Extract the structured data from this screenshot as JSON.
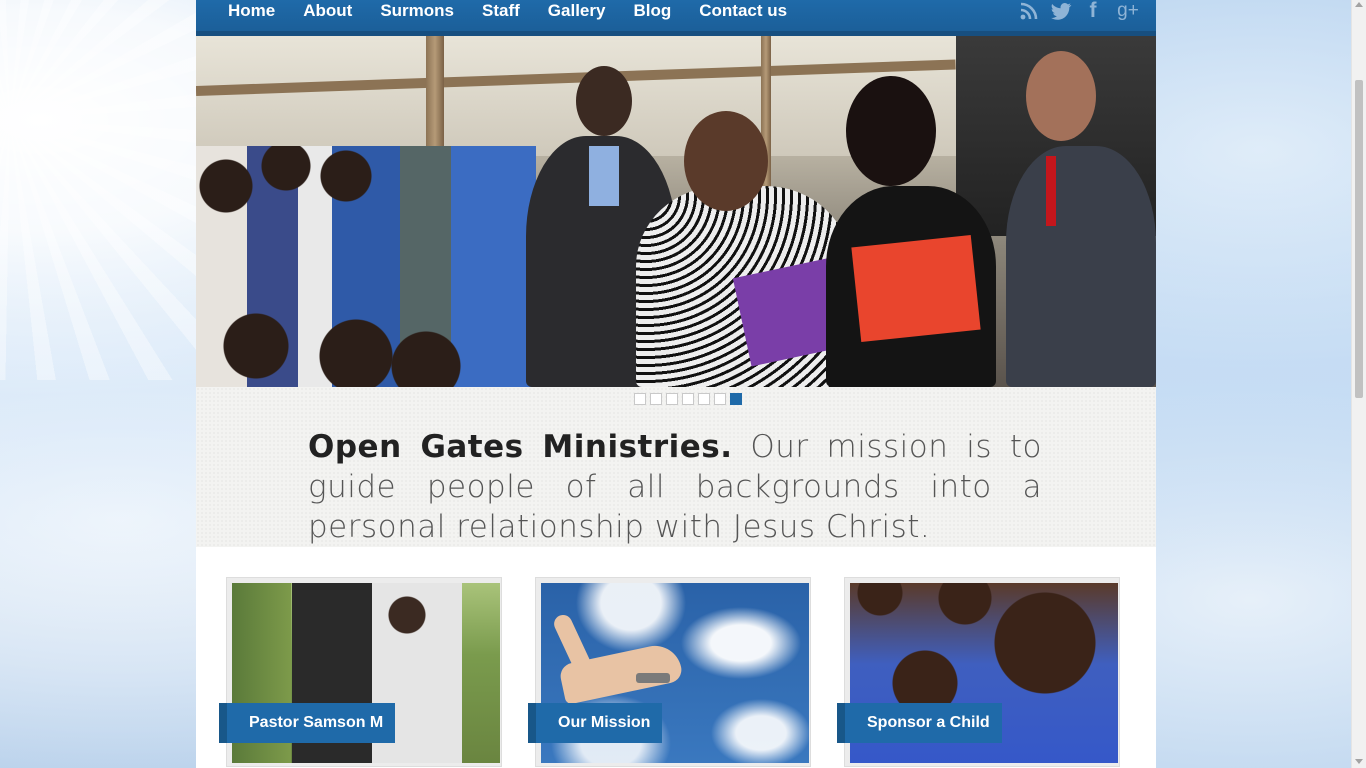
{
  "nav": {
    "links": [
      "Home",
      "About",
      "Surmons",
      "Staff",
      "Gallery",
      "Blog",
      "Contact us"
    ]
  },
  "social": {
    "rss": "rss-icon",
    "twitter": "twitter-icon",
    "facebook": "facebook-icon",
    "googleplus": "google-plus-icon",
    "twitter_glyph": "🐦",
    "facebook_glyph": "f",
    "googleplus_glyph": "g+"
  },
  "slider": {
    "dot_count": 7,
    "active_index": 6
  },
  "tagline": {
    "name": "Open Gates Ministries.",
    "text": " Our mission is to guide people of all backgrounds into a personal relationship with Jesus Christ."
  },
  "cards": [
    {
      "label": "Pastor Samson M"
    },
    {
      "label": "Our Mission"
    },
    {
      "label": "Sponsor a Child"
    }
  ],
  "colors": {
    "brand_blue": "#1f6aa9",
    "nav_bottom": "#174f80"
  }
}
